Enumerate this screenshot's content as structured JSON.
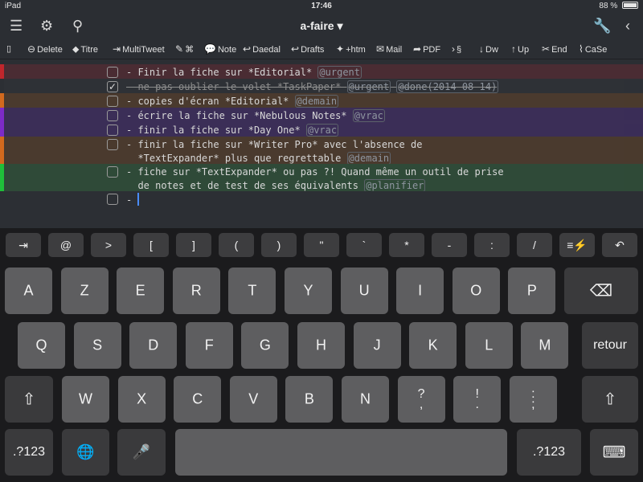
{
  "status": {
    "device": "iPad",
    "time": "17:46",
    "battery": "88 %",
    "battery_level": 0.88
  },
  "navbar": {
    "title": "a-faire ▾"
  },
  "toolbar": [
    {
      "id": "delete",
      "icon": "circle-arrow-icon",
      "glyph": "⊖",
      "label": "Delete"
    },
    {
      "id": "titre",
      "icon": "tag-icon",
      "glyph": "⬥",
      "label": "Titre"
    },
    {
      "id": "multitweet",
      "icon": "export-icon",
      "glyph": "⇥",
      "label": "MultiTweet"
    },
    {
      "id": "cmd",
      "icon": "edit-icon",
      "glyph": "✎",
      "label": "⌘"
    },
    {
      "id": "note",
      "icon": "speech-bubble-icon",
      "glyph": "💬",
      "label": "Note"
    },
    {
      "id": "daedal",
      "icon": "reply-icon",
      "glyph": "↩",
      "label": "Daedal"
    },
    {
      "id": "drafts",
      "icon": "reply-icon",
      "glyph": "↩",
      "label": "Drafts"
    },
    {
      "id": "htm",
      "icon": "pin-icon",
      "glyph": "✦",
      "label": "+htm"
    },
    {
      "id": "mail",
      "icon": "mail-icon",
      "glyph": "✉",
      "label": "Mail"
    },
    {
      "id": "pdf",
      "icon": "share-icon",
      "glyph": "➦",
      "label": "PDF"
    },
    {
      "id": "section",
      "icon": "chevron-right-icon",
      "glyph": "›",
      "label": "§"
    },
    {
      "id": "dw",
      "icon": "arrow-down-icon",
      "glyph": "↓",
      "label": "Dw"
    },
    {
      "id": "up",
      "icon": "arrow-up-icon",
      "glyph": "↑",
      "label": "Up"
    },
    {
      "id": "end",
      "icon": "tools-icon",
      "glyph": "✂",
      "label": "End"
    },
    {
      "id": "case",
      "icon": "chart-icon",
      "glyph": "⌇",
      "label": "CaSe"
    }
  ],
  "tasks": [
    {
      "text": "- Finir la fiche sur *Editorial* ",
      "tags": [
        "@urgent"
      ],
      "checked": false,
      "color": "#c0262c",
      "bg": "#4a2c33"
    },
    {
      "text": "- ne pas oublier le volet *TaskPaper* ",
      "tags": [
        "@urgent",
        "@done(2014-08-14)"
      ],
      "checked": true,
      "color": "#2c2f34",
      "bg": "#2e3136"
    },
    {
      "text": "- copies d'écran *Editorial* ",
      "tags": [
        "@demain"
      ],
      "checked": false,
      "color": "#d2691e",
      "bg": "#4a3a2e"
    },
    {
      "text": "- écrire la fiche sur *Nebulous Notes* ",
      "tags": [
        "@vrac"
      ],
      "checked": false,
      "color": "#7d2bc8",
      "bg": "#3b2e57"
    },
    {
      "text": "- finir la fiche sur *Day One* ",
      "tags": [
        "@vrac"
      ],
      "checked": false,
      "color": "#7d2bc8",
      "bg": "#3b2e57"
    },
    {
      "text": "- finir la fiche sur *Writer Pro* avec l'absence de\n  *TextExpander* plus que regrettable ",
      "tags": [
        "@demain"
      ],
      "checked": false,
      "color": "#d2691e",
      "bg": "#4a3a2e"
    },
    {
      "text": "- fiche sur *TextExpander* ou pas ?! Quand même un outil de prise\n  de notes et de test de ses équivalents ",
      "tags": [
        "@planifier"
      ],
      "checked": false,
      "color": "#1fbf3a",
      "bg": "#2f4a38"
    },
    {
      "text": "- ",
      "tags": [],
      "checked": false,
      "color": "#2c2f34",
      "bg": "#2c2f34"
    }
  ],
  "extra_keys": [
    "⇥",
    "@",
    ">",
    "[",
    "]",
    "(",
    ")",
    "\"",
    "`",
    "*",
    "-",
    ":",
    "/",
    "≡⚡",
    "↶"
  ],
  "keyboard": {
    "row1": [
      "A",
      "Z",
      "E",
      "R",
      "T",
      "Y",
      "U",
      "I",
      "O",
      "P"
    ],
    "row2": [
      "Q",
      "S",
      "D",
      "F",
      "G",
      "H",
      "J",
      "K",
      "L",
      "M"
    ],
    "row3": [
      "W",
      "X",
      "C",
      "V",
      "B",
      "N",
      "?\n,",
      "!\n.",
      ":\n;"
    ],
    "retour": "retour",
    "numbers": ".?123",
    "backspace": "⌫",
    "shift": "⇧",
    "globe": "🌐",
    "mic": "🎤",
    "hide": "⌨"
  }
}
